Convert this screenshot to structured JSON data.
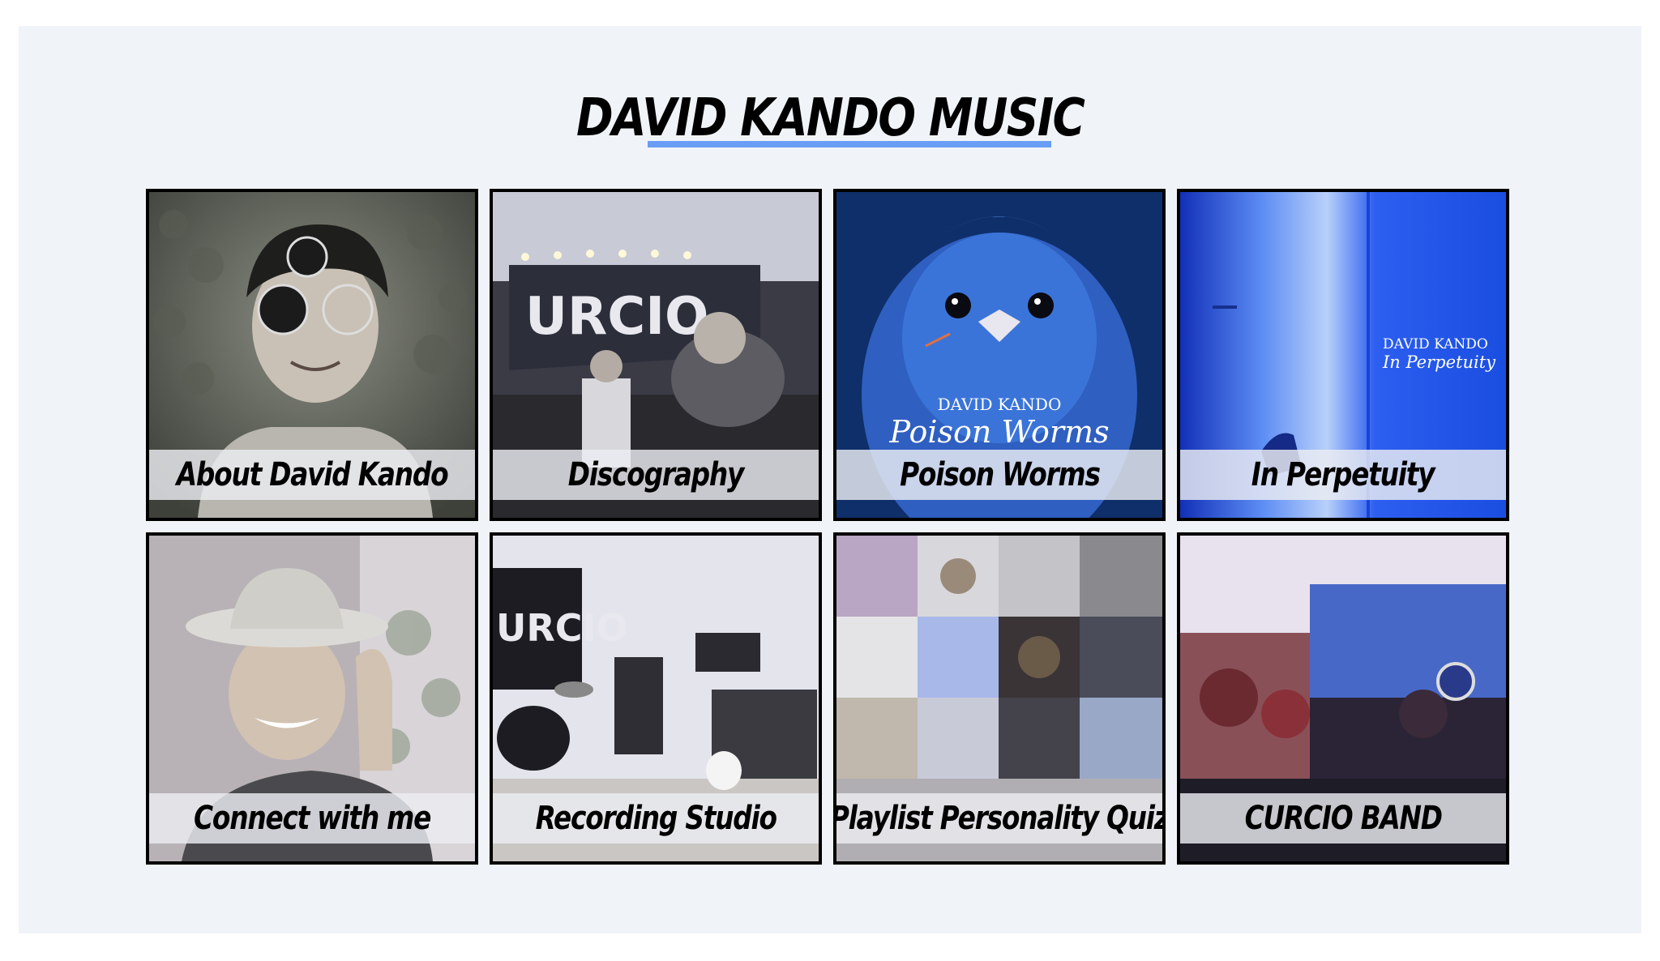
{
  "header": {
    "title": "DAVID KANDO MUSIC",
    "underline_color": "#6a9df5"
  },
  "tiles": [
    {
      "label": "About David Kando",
      "icon": "portrait-photo"
    },
    {
      "label": "Discography",
      "icon": "live-band-photo"
    },
    {
      "label": "Poison Worms",
      "icon": "blue-bird-cover",
      "cover_artist": "DAVID KANDO",
      "cover_title": "Poison Worms"
    },
    {
      "label": "In Perpetuity",
      "icon": "blue-room-cover",
      "cover_artist": "DAVID KANDO",
      "cover_title": "In Perpetuity"
    },
    {
      "label": "Connect with me",
      "icon": "smiling-hat-photo"
    },
    {
      "label": "Recording Studio",
      "icon": "studio-photo"
    },
    {
      "label": "Playlist Personality Quiz",
      "icon": "album-collage"
    },
    {
      "label": "CURCIO BAND",
      "icon": "concert-photo"
    }
  ],
  "colors": {
    "background": "#f0f4f8",
    "border": "#000000",
    "label_band": "#ebedf2"
  }
}
